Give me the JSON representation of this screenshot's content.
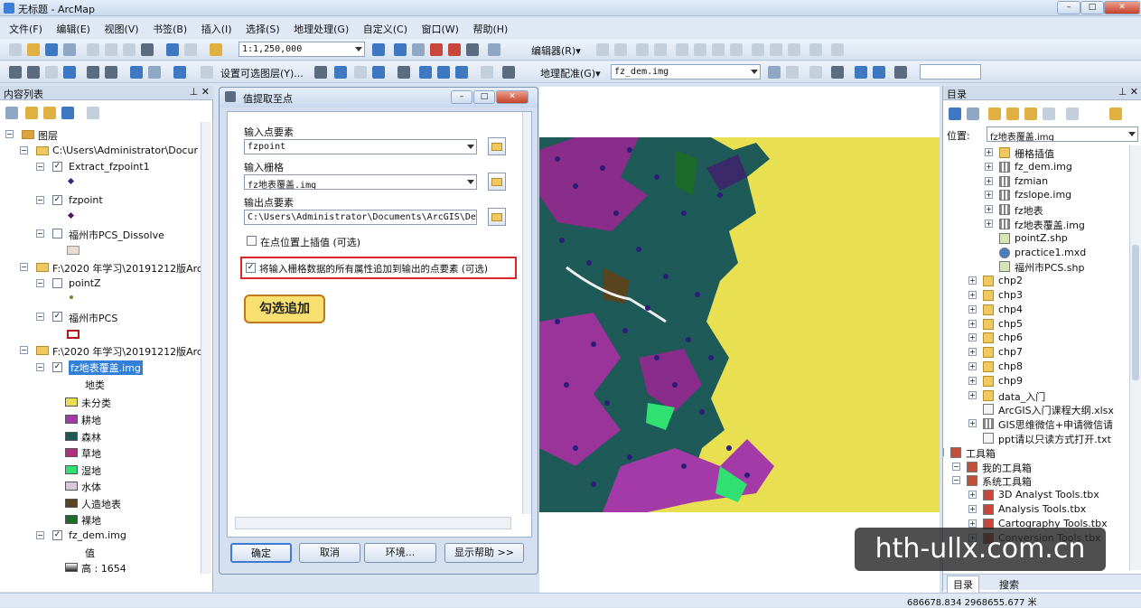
{
  "window": {
    "title": "无标题 - ArcMap"
  },
  "menu": [
    "文件(F)",
    "编辑(E)",
    "视图(V)",
    "书签(B)",
    "插入(I)",
    "选择(S)",
    "地理处理(G)",
    "自定义(C)",
    "窗口(W)",
    "帮助(H)"
  ],
  "toolbar1": {
    "scale": "1:1,250,000",
    "editor": "编辑器(R)▾"
  },
  "toolbar2": {
    "selectable_layers": "设置可选图层(Y)...",
    "georef": "地理配准(G)▾",
    "raster": "fz_dem.img"
  },
  "toc": {
    "title": "内容列表",
    "rows": [
      {
        "label": "图层",
        "expanded": true
      },
      {
        "label": "C:\\Users\\Administrator\\Docur",
        "expanded": true
      },
      {
        "label": "Extract_fzpoint1",
        "checked": true
      },
      {
        "label": "fzpoint",
        "checked": true
      },
      {
        "label": "福州市PCS_Dissolve",
        "checked": false
      },
      {
        "label": "F:\\2020 年学习\\20191212版Arc",
        "expanded": true
      },
      {
        "label": "pointZ",
        "checked": false
      },
      {
        "label": "福州市PCS",
        "checked": true
      },
      {
        "label": "F:\\2020 年学习\\20191212版Arc",
        "expanded": true
      },
      {
        "label": "fz地表覆盖.img",
        "checked": true,
        "selected": true
      },
      {
        "label": "地类"
      },
      {
        "label": "fz_dem.img",
        "checked": true
      },
      {
        "label": "值"
      },
      {
        "label": "高 : 1654"
      }
    ],
    "legend": [
      {
        "label": "未分类",
        "color": "#e8e050"
      },
      {
        "label": "耕地",
        "color": "#a43aa8"
      },
      {
        "label": "森林",
        "color": "#1c5a55"
      },
      {
        "label": "草地",
        "color": "#b0307a"
      },
      {
        "label": "湿地",
        "color": "#30e070"
      },
      {
        "label": "水体",
        "color": "#d8c8d8"
      },
      {
        "label": "人造地表",
        "color": "#5a4420"
      },
      {
        "label": "裸地",
        "color": "#1d6a2a"
      }
    ]
  },
  "dialog": {
    "title": "值提取至点",
    "input_points_label": "输入点要素",
    "input_points_value": "fzpoint",
    "input_raster_label": "输入栅格",
    "input_raster_value": "fz地表覆盖.img",
    "output_label": "输出点要素",
    "output_value": "C:\\Users\\Administrator\\Documents\\ArcGIS\\Defaul",
    "interpolate_label": "在点位置上插值 (可选)",
    "interpolate_checked": false,
    "append_label": "将输入栅格数据的所有属性追加到输出的点要素 (可选)",
    "append_checked": true,
    "callout": "勾选追加",
    "buttons": {
      "ok": "确定",
      "cancel": "取消",
      "env": "环境...",
      "help": "显示帮助 >>"
    }
  },
  "catalog": {
    "title": "目录",
    "location_label": "位置:",
    "location_value": "fz地表覆盖.img",
    "items": [
      {
        "label": "栅格插值",
        "type": "folder"
      },
      {
        "label": "fz_dem.img",
        "type": "raster"
      },
      {
        "label": "fzmian",
        "type": "raster"
      },
      {
        "label": "fzslope.img",
        "type": "raster"
      },
      {
        "label": "fz地表",
        "type": "raster"
      },
      {
        "label": "fz地表覆盖.img",
        "type": "raster"
      },
      {
        "label": "pointZ.shp",
        "type": "shape"
      },
      {
        "label": "practice1.mxd",
        "type": "mxd"
      },
      {
        "label": "福州市PCS.shp",
        "type": "shape"
      },
      {
        "label": "chp2",
        "type": "folder"
      },
      {
        "label": "chp3",
        "type": "folder"
      },
      {
        "label": "chp4",
        "type": "folder"
      },
      {
        "label": "chp5",
        "type": "folder"
      },
      {
        "label": "chp6",
        "type": "folder"
      },
      {
        "label": "chp7",
        "type": "folder"
      },
      {
        "label": "chp8",
        "type": "folder"
      },
      {
        "label": "chp9",
        "type": "folder"
      },
      {
        "label": "data_入门",
        "type": "folder"
      },
      {
        "label": "ArcGIS入门课程大纲.xlsx",
        "type": "file"
      },
      {
        "label": "GIS思维微信+申请微信请",
        "type": "raster"
      },
      {
        "label": "ppt请以只读方式打开.txt",
        "type": "file"
      },
      {
        "label": "工具箱",
        "type": "toolbox"
      },
      {
        "label": "我的工具箱",
        "type": "toolbox"
      },
      {
        "label": "系统工具箱",
        "type": "toolbox"
      },
      {
        "label": "3D Analyst Tools.tbx",
        "type": "tbx"
      },
      {
        "label": "Analysis Tools.tbx",
        "type": "tbx"
      },
      {
        "label": "Cartography Tools.tbx",
        "type": "tbx"
      },
      {
        "label": "Conversion Tools.tbx",
        "type": "tbx"
      }
    ],
    "tabs": [
      "目录",
      "搜索"
    ]
  },
  "status": {
    "coords": "686678.834 2968655.677 米"
  },
  "watermark": "hth-ullx.com.cn"
}
